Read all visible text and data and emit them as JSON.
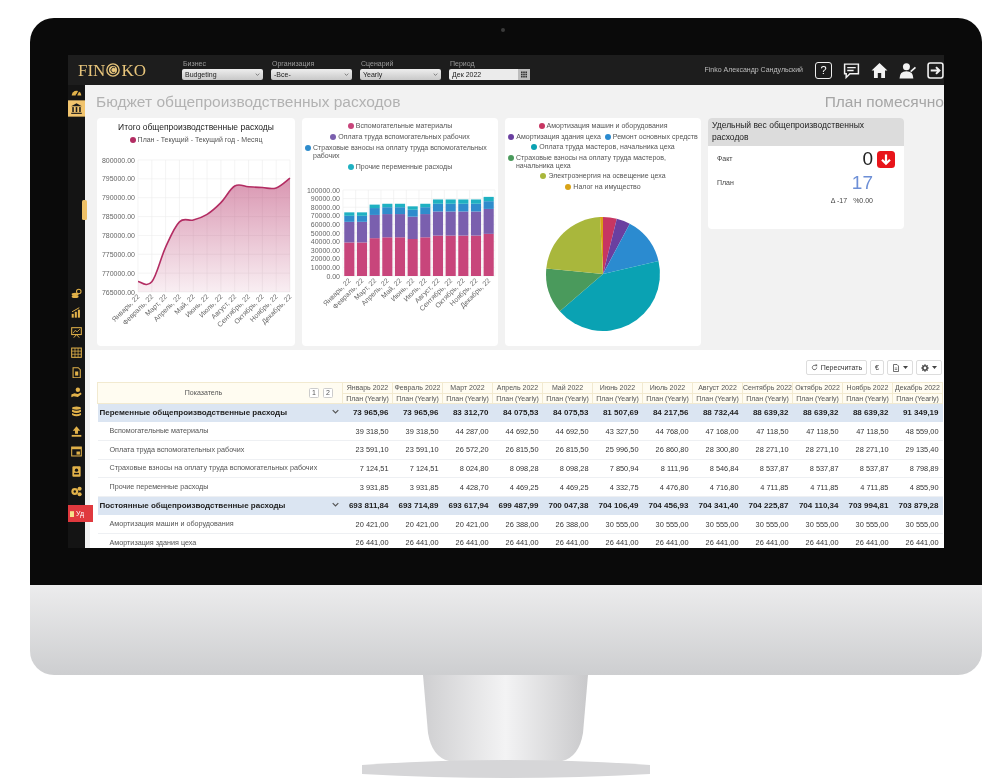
{
  "topbar": {
    "logo": {
      "left": "FIN",
      "right": "KO"
    },
    "filters": [
      {
        "kind": "select",
        "label": "Бизнес",
        "value": "Budgeting"
      },
      {
        "kind": "select",
        "label": "Организация",
        "value": "-Все-"
      },
      {
        "kind": "select",
        "label": "Сценарий",
        "value": "Yearly"
      },
      {
        "kind": "date",
        "label": "Период",
        "value": "Дек 2022"
      }
    ],
    "user": "Finko Александр Сандульский",
    "help": "?"
  },
  "sidebar": {
    "items": [
      {
        "selected": false
      },
      {
        "selected": true
      }
    ],
    "tools": [
      {
        "selected": false
      },
      {
        "selected": false
      },
      {
        "selected": false
      },
      {
        "selected": false
      },
      {
        "selected": false
      },
      {
        "selected": false
      },
      {
        "selected": false
      },
      {
        "selected": false
      },
      {
        "selected": false
      },
      {
        "selected": false
      },
      {
        "selected": false
      }
    ],
    "delete_button": "Уд"
  },
  "page": {
    "title": "Бюджет общепроизводственных расходов",
    "view": "План помесячно"
  },
  "line_chart": {
    "chart_data": {
      "type": "area",
      "title": "Итого общепроизводственные расходы",
      "legend": "top",
      "grid": true,
      "categories": [
        "Январь, 22",
        "Февраль, 22",
        "Март, 22",
        "Апрель, 22",
        "Май, 22",
        "Июнь, 22",
        "Июль, 22",
        "Август, 22",
        "Сентябрь, 22",
        "Октябрь, 22",
        "Ноябрь, 22",
        "Декабрь, 22"
      ],
      "series": [
        {
          "name": "План - Текущий - Текущий год - Месяц",
          "color": "#b32d63",
          "values": [
            767800,
            767700,
            776900,
            783600,
            784100,
            785600,
            788700,
            793100,
            792900,
            792700,
            792600,
            795200
          ]
        }
      ],
      "ylim": [
        765000,
        800000
      ],
      "yticks": [
        {
          "value": 765000,
          "label": "765000.00"
        },
        {
          "value": 770000,
          "label": "770000.00"
        },
        {
          "value": 775000,
          "label": "775000.00"
        },
        {
          "value": 780000,
          "label": "780000.00"
        },
        {
          "value": 785000,
          "label": "785000.00"
        },
        {
          "value": 790000,
          "label": "790000.00"
        },
        {
          "value": 795000,
          "label": "795000.00"
        },
        {
          "value": 800000,
          "label": "800000.00"
        }
      ]
    }
  },
  "bar_chart": {
    "chart_data": {
      "type": "bar",
      "stacked": true,
      "legend": "top",
      "grid": true,
      "categories": [
        "Январь, 22",
        "Февраль, 22",
        "Март, 22",
        "Апрель, 22",
        "Май, 22",
        "Июнь, 22",
        "Июль, 22",
        "Август, 22",
        "Сентябрь, 22",
        "Октябрь, 22",
        "Ноябрь, 22",
        "Декабрь, 22"
      ],
      "series": [
        {
          "name": "Вспомогательные материалы",
          "color": "#c8457b",
          "values": [
            39000,
            39000,
            44000,
            45000,
            45000,
            43000,
            45000,
            47000,
            47000,
            47000,
            47000,
            49000
          ]
        },
        {
          "name": "Оплата труда вспомогательных рабочих",
          "color": "#7a5fae",
          "values": [
            24000,
            24000,
            27000,
            27000,
            27000,
            26000,
            27000,
            28000,
            28000,
            28000,
            28000,
            29000
          ]
        },
        {
          "name": "Страховые взносы на оплату труда вспомогательных рабочих",
          "color": "#2f8ccc",
          "values": [
            7000,
            7000,
            8000,
            8000,
            8000,
            8000,
            8000,
            9000,
            9000,
            9000,
            9000,
            9000
          ]
        },
        {
          "name": "Прочие переменные расходы",
          "color": "#1fb1c2",
          "values": [
            4000,
            4000,
            4000,
            4000,
            4000,
            4000,
            4000,
            5000,
            5000,
            5000,
            5000,
            5000
          ]
        }
      ],
      "ylim": [
        0,
        100000
      ],
      "yticks": [
        {
          "value": 0,
          "label": "0.00"
        },
        {
          "value": 10000,
          "label": "10000.00"
        },
        {
          "value": 20000,
          "label": "20000.00"
        },
        {
          "value": 30000,
          "label": "30000.00"
        },
        {
          "value": 40000,
          "label": "40000.00"
        },
        {
          "value": 50000,
          "label": "50000.00"
        },
        {
          "value": 60000,
          "label": "60000.00"
        },
        {
          "value": 70000,
          "label": "70000.00"
        },
        {
          "value": 80000,
          "label": "80000.00"
        },
        {
          "value": 90000,
          "label": "90000.00"
        },
        {
          "value": 100000,
          "label": "100000.00"
        }
      ]
    }
  },
  "pie_chart": {
    "legend": [
      {
        "label": "Амортизация машин и оборудования",
        "color": "#c73662"
      },
      {
        "label": "Амортизация здания цеха",
        "color": "#6a3fa0"
      },
      {
        "label": "Ремонт основных средств",
        "color": "#2b8bd0"
      },
      {
        "label": "Оплата труда мастеров, начальника цеха",
        "color": "#0aa2b3"
      },
      {
        "label": "Страховые взносы на оплату труда мастеров, начальника цеха",
        "color": "#4a9a5c"
      },
      {
        "label": "Электроэнергия на освещение цеха",
        "color": "#a9b73c"
      },
      {
        "label": "Налог на имущество",
        "color": "#d8a317"
      }
    ]
  },
  "kpi_card": {
    "title": "Удельный вес общепроизводственных расходов",
    "fact_label": "Факт",
    "fact_value": "0",
    "trend_icon": {
      "kind": "down"
    },
    "plan_label": "План",
    "plan_value": "17",
    "delta": "Δ -17",
    "percent": "%0.00"
  },
  "toolbar": {
    "recalculate": "Пересчитать",
    "currency": "€"
  },
  "table": {
    "header": "Показатель",
    "levels": [
      "1",
      "2"
    ],
    "columns": [
      {
        "month": "Январь 2022",
        "scenario": "План (Yearly)"
      },
      {
        "month": "Февраль 2022",
        "scenario": "План (Yearly)"
      },
      {
        "month": "Март 2022",
        "scenario": "План (Yearly)"
      },
      {
        "month": "Апрель 2022",
        "scenario": "План (Yearly)"
      },
      {
        "month": "Май 2022",
        "scenario": "План (Yearly)"
      },
      {
        "month": "Июнь 2022",
        "scenario": "План (Yearly)"
      },
      {
        "month": "Июль 2022",
        "scenario": "План (Yearly)"
      },
      {
        "month": "Август 2022",
        "scenario": "План (Yearly)"
      },
      {
        "month": "Сентябрь 2022",
        "scenario": "План (Yearly)"
      },
      {
        "month": "Октябрь 2022",
        "scenario": "План (Yearly)"
      },
      {
        "month": "Ноябрь 2022",
        "scenario": "План (Yearly)"
      },
      {
        "month": "Декабрь 2022",
        "scenario": "План (Yearly)"
      }
    ],
    "rows": [
      {
        "label": "Переменные общепроизводственные расходы",
        "expanded": true,
        "values": [
          "73 965,96",
          "73 965,96",
          "83 312,70",
          "84 075,53",
          "84 075,53",
          "81 507,69",
          "84 217,56",
          "88 732,44",
          "88 639,32",
          "88 639,32",
          "88 639,32",
          "91 349,19"
        ],
        "children": [
          {
            "label": "Вспомогательные материалы",
            "values": [
              "39 318,50",
              "39 318,50",
              "44 287,00",
              "44 692,50",
              "44 692,50",
              "43 327,50",
              "44 768,00",
              "47 168,00",
              "47 118,50",
              "47 118,50",
              "47 118,50",
              "48 559,00"
            ]
          },
          {
            "label": "Оплата труда вспомогательных рабочих",
            "values": [
              "23 591,10",
              "23 591,10",
              "26 572,20",
              "26 815,50",
              "26 815,50",
              "25 996,50",
              "26 860,80",
              "28 300,80",
              "28 271,10",
              "28 271,10",
              "28 271,10",
              "29 135,40"
            ]
          },
          {
            "label": "Страховые взносы на оплату труда вспомогательных рабочих",
            "values": [
              "7 124,51",
              "7 124,51",
              "8 024,80",
              "8 098,28",
              "8 098,28",
              "7 850,94",
              "8 111,96",
              "8 546,84",
              "8 537,87",
              "8 537,87",
              "8 537,87",
              "8 798,89"
            ]
          },
          {
            "label": "Прочие переменные расходы",
            "values": [
              "3 931,85",
              "3 931,85",
              "4 428,70",
              "4 469,25",
              "4 469,25",
              "4 332,75",
              "4 476,80",
              "4 716,80",
              "4 711,85",
              "4 711,85",
              "4 711,85",
              "4 855,90"
            ]
          }
        ]
      },
      {
        "label": "Постоянные общепроизводственные расходы",
        "expanded": true,
        "values": [
          "693 811,84",
          "693 714,89",
          "693 617,94",
          "699 487,99",
          "700 047,38",
          "704 106,49",
          "704 456,93",
          "704 341,40",
          "704 225,87",
          "704 110,34",
          "703 994,81",
          "703 879,28"
        ],
        "children": [
          {
            "label": "Амортизация машин и оборудования",
            "values": [
              "20 421,00",
              "20 421,00",
              "20 421,00",
              "26 388,00",
              "26 388,00",
              "30 555,00",
              "30 555,00",
              "30 555,00",
              "30 555,00",
              "30 555,00",
              "30 555,00",
              "30 555,00"
            ]
          },
          {
            "label": "Амортизация здания цеха",
            "values": [
              "26 441,00",
              "26 441,00",
              "26 441,00",
              "26 441,00",
              "26 441,00",
              "26 441,00",
              "26 441,00",
              "26 441,00",
              "26 441,00",
              "26 441,00",
              "26 441,00",
              "26 441,00"
            ]
          }
        ]
      }
    ]
  }
}
